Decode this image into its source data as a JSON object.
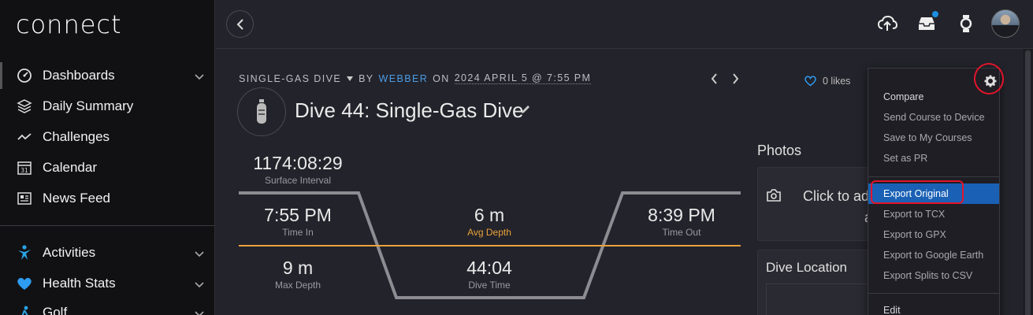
{
  "app": {
    "logo": "connect"
  },
  "sidebar": {
    "items": [
      {
        "label": "Dashboards",
        "icon": "gauge-icon",
        "expandable": true
      },
      {
        "label": "Daily Summary",
        "icon": "layers-icon",
        "expandable": false
      },
      {
        "label": "Challenges",
        "icon": "trend-icon",
        "expandable": false
      },
      {
        "label": "Calendar",
        "icon": "calendar-icon",
        "badge": "31",
        "expandable": false
      },
      {
        "label": "News Feed",
        "icon": "newspaper-icon",
        "expandable": false
      },
      {
        "label": "Activities",
        "icon": "person-icon",
        "expandable": true
      },
      {
        "label": "Health Stats",
        "icon": "heart-icon",
        "expandable": true
      },
      {
        "label": "Golf",
        "icon": "golf-icon",
        "expandable": true
      }
    ]
  },
  "activity": {
    "type": "SINGLE-GAS DIVE",
    "by_text": "BY",
    "user": "WEBBER",
    "on_text": "ON",
    "date": "2024 APRIL 5 @ 7:55 PM",
    "title": "Dive 44: Single-Gas Dive"
  },
  "stats": {
    "surface_interval": {
      "value": "1174:08:29",
      "label": "Surface Interval"
    },
    "time_in": {
      "value": "7:55 PM",
      "label": "Time In"
    },
    "avg_depth": {
      "value": "6 m",
      "label": "Avg Depth"
    },
    "time_out": {
      "value": "8:39 PM",
      "label": "Time Out"
    },
    "max_depth": {
      "value": "9 m",
      "label": "Max Depth"
    },
    "dive_time": {
      "value": "44:04",
      "label": "Dive Time"
    }
  },
  "social": {
    "likes": "0 likes"
  },
  "photos": {
    "heading": "Photos",
    "prompt_line1": "Click to ad",
    "prompt_line2": "a"
  },
  "location": {
    "heading": "Dive Location"
  },
  "menu": {
    "items": [
      {
        "label": "Compare",
        "style": "normal"
      },
      {
        "label": "Send Course to Device",
        "style": "muted"
      },
      {
        "label": "Save to My Courses",
        "style": "muted"
      },
      {
        "label": "Set as PR",
        "style": "muted"
      },
      {
        "label": "Export Original",
        "style": "selected"
      },
      {
        "label": "Export to TCX",
        "style": "muted"
      },
      {
        "label": "Export to GPX",
        "style": "muted"
      },
      {
        "label": "Export to Google Earth",
        "style": "muted"
      },
      {
        "label": "Export Splits to CSV",
        "style": "muted"
      },
      {
        "label": "Edit",
        "style": "normal"
      }
    ]
  },
  "colors": {
    "accent_blue": "#1a61b5",
    "link_blue": "#4a9de6",
    "depth_orange": "#e8a23a",
    "annotation_red": "#e3142b",
    "heart_blue": "#2e9cf0",
    "activities_blue": "#29a3e6"
  }
}
